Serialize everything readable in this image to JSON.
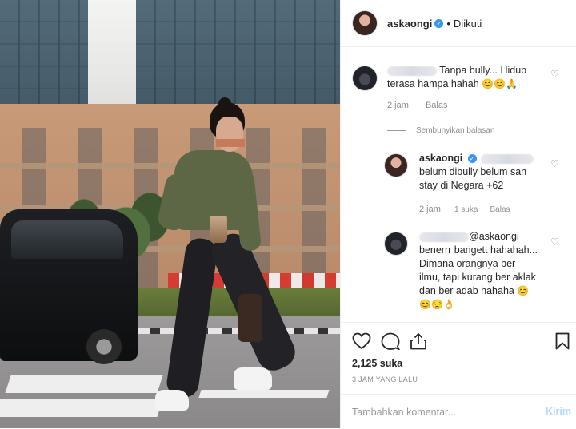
{
  "post": {
    "username": "askaongi",
    "separator": "•",
    "follow_state": "Diikuti"
  },
  "comments": [
    {
      "text_line1": "Tanpa bully... Hidup",
      "text_line2": "terasa hampa hahah",
      "emojis": "😊😊🙏",
      "time": "2 jam",
      "reply": "Balas"
    }
  ],
  "hide_replies": "Sembunyikan balasan",
  "replies": [
    {
      "username": "askaongi",
      "text_line1": "belum dibully belum sah",
      "text_line2": "stay di Negara +62",
      "time": "2 jam",
      "likes": "1 suka",
      "reply": "Balas"
    },
    {
      "mention": "@askaongi",
      "text_line1": "benerrr bangett hahahah...",
      "text_line2": "Dimana orangnya ber",
      "text_line3": "ilmu, tapi kurang ber aklak",
      "text_line4": "dan ber adab hahaha",
      "emoji_end": "😊",
      "emoji_line5": "😊😒👌"
    }
  ],
  "actions": {
    "like_icon": "heart-icon",
    "comment_icon": "comment-icon",
    "share_icon": "share-icon",
    "save_icon": "bookmark-icon"
  },
  "likes": "2,125 suka",
  "time_ago": "3 JAM YANG LALU",
  "comment_input": {
    "placeholder": "Tambahkan komentar...",
    "send": "Kirim"
  },
  "colors": {
    "verified": "#3897f0",
    "muted": "#8e8e8e",
    "send_disabled": "#b3dbff"
  }
}
